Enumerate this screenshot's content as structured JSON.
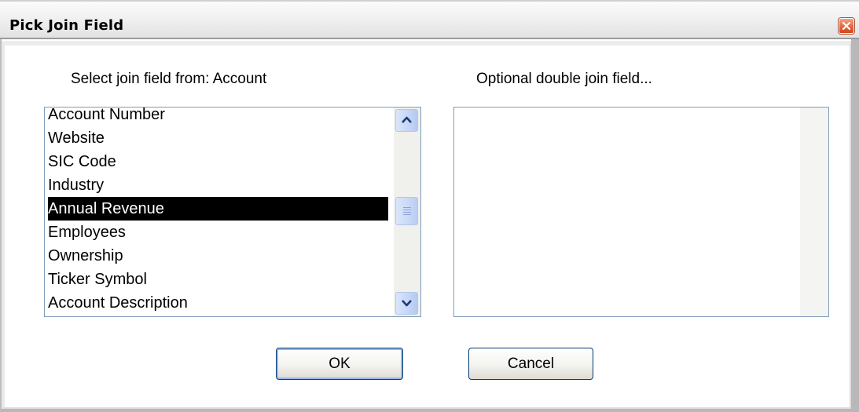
{
  "window": {
    "title": "Pick Join Field"
  },
  "left_panel": {
    "label": "Select join field from: Account",
    "items": [
      "Account Number",
      "Website",
      "SIC Code",
      "Industry",
      "Annual Revenue",
      "Employees",
      "Ownership",
      "Ticker Symbol",
      "Account Description"
    ],
    "selected_item": "Annual Revenue"
  },
  "right_panel": {
    "label": "Optional double join field...",
    "items": []
  },
  "buttons": {
    "ok_label": "OK",
    "cancel_label": "Cancel"
  },
  "icons": {
    "close": "close-icon",
    "scroll_up": "chevron-up-icon",
    "scroll_down": "chevron-down-icon",
    "thumb_grip": "grip-icon"
  },
  "colors": {
    "selection_bg": "#000000",
    "selection_text": "#ffffff",
    "listbox_border": "#7f9db9",
    "close_button": "#e5663f",
    "button_border": "#003c74"
  }
}
